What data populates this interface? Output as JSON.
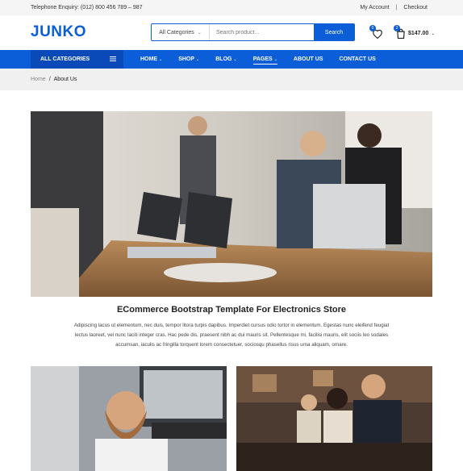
{
  "topbar": {
    "phone": "Telephone Enquiry: (012) 800 456 789 – 987",
    "links": [
      "My Account",
      "Checkout"
    ],
    "separator": "|"
  },
  "header": {
    "logo": "JUNKO",
    "search": {
      "category": "All Categories",
      "placeholder": "Search product...",
      "button": "Search"
    },
    "wishlist_count": "0",
    "cart_count": "2",
    "cart_total": "$147.00"
  },
  "nav": {
    "all_categories": "ALL CATEGORIES",
    "items": [
      {
        "label": "HOME",
        "has_dropdown": true
      },
      {
        "label": "SHOP",
        "has_dropdown": true
      },
      {
        "label": "BLOG",
        "has_dropdown": true
      },
      {
        "label": "PAGES",
        "has_dropdown": true
      },
      {
        "label": "ABOUT US",
        "has_dropdown": false
      },
      {
        "label": "CONTACT US",
        "has_dropdown": false
      }
    ],
    "chevron": "⌄"
  },
  "breadcrumb": {
    "home": "Home",
    "separator": "/",
    "current": "About Us"
  },
  "content": {
    "title": "ECommerce Bootstrap Template For Electronics Store",
    "text": "Adipiscing lacus ut elementum, nec duis, tempor litora turpis dapibus. Imperdiet cursus odio tortor in elementum. Egestas nunc eleifend feugiat lectus laoreet, vel nunc taciti integer cras. Hac pede dis, praesent nibh ac dui mauris sit. Pellentesque mi, facilisi mauris, elit sociis leo sodales accumsan, iaculis ac fringilla torquent lorem consectetuer, sociosqu phasellus risus urna aliquam, ornare."
  },
  "colors": {
    "brand": "#0b5ed7",
    "nav_dark": "#0a4ab8",
    "topbar_bg": "#f5f5f5",
    "breadcrumb_bg": "#f0f0f0"
  }
}
